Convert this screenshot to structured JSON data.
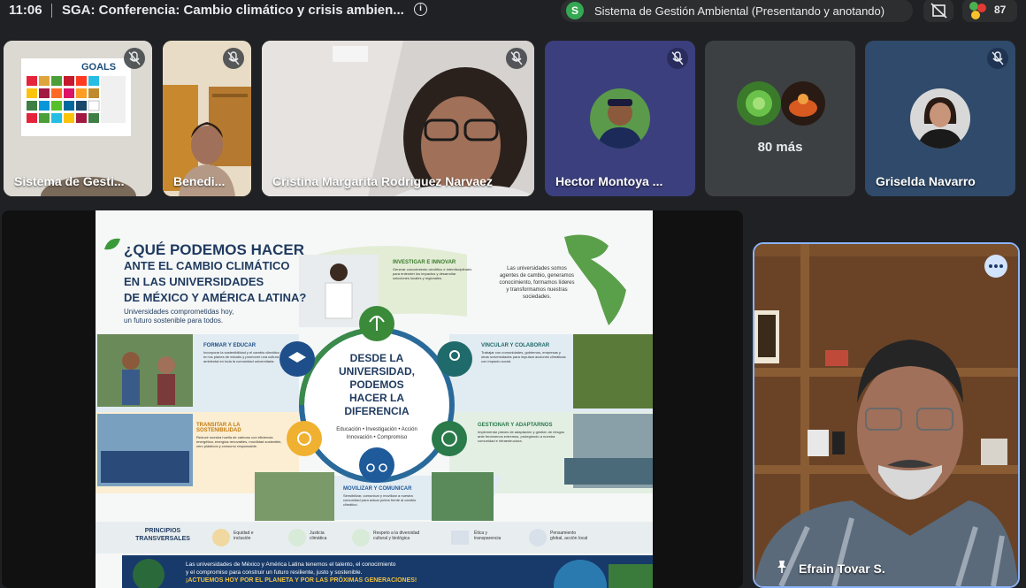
{
  "topbar": {
    "time": "11:06",
    "meeting_title": "SGA: Conferencia: Cambio climático y crisis ambien...",
    "presenter_initial": "S",
    "presenter_status": "Sistema de Gestión Ambiental (Presentando y anotando)",
    "participants_count": "87"
  },
  "tiles": [
    {
      "name": "Sistema de Gesti..."
    },
    {
      "name": "Benedi..."
    },
    {
      "name": "Cristina Margarita Rodriguez Narvaez"
    },
    {
      "name": "Hector Montoya ..."
    },
    {
      "name": "80 más"
    },
    {
      "name": "Griselda Navarro"
    }
  ],
  "sdg_poster": {
    "text": "GOALS"
  },
  "slide": {
    "title_line1": "¿QUÉ PODEMOS HACER",
    "title_line2": "ANTE EL CAMBIO CLIMÁTICO",
    "title_line3": "EN LAS UNIVERSIDADES",
    "title_line4": "DE MÉXICO Y AMÉRICA LATINA?",
    "subtitle_line1": "Universidades comprometidas hoy,",
    "subtitle_line2": "un futuro sostenible para todos.",
    "center_line1": "DESDE LA",
    "center_line2": "UNIVERSIDAD,",
    "center_line3": "PODEMOS",
    "center_line4": "HACER LA",
    "center_line5": "DIFERENCIA",
    "center_sub1": "Educación • Investigación • Acción",
    "center_sub2": "Innovación • Compromiso",
    "intro_line1": "Las universidades somos",
    "intro_line2": "agentes de cambio, generamos",
    "intro_line3": "conocimiento, formamos líderes",
    "intro_line4": "y transformamos nuestras",
    "intro_line5": "sociedades.",
    "sections": [
      {
        "title": "INVESTIGAR E INNOVAR",
        "text": "Generar conocimiento científico e interdisciplinario para entender los impactos y desarrollar soluciones locales y regionales."
      },
      {
        "title": "FORMAR Y EDUCAR",
        "text": "Incorporar la sostenibilidad y el cambio climático en los planes de estudio y promover una cultura ambiental en toda la comunidad universitaria."
      },
      {
        "title": "VINCULAR Y COLABORAR",
        "text": "Trabajar con comunidades, gobiernos, empresas y otras universidades para impulsar acciones climáticas con impacto social."
      },
      {
        "title": "TRANSITAR A LA SOSTENIBILIDAD",
        "text": "Reducir nuestra huella de carbono con eficiencia energética, energías renovables, movilidad sostenible, cero plásticos y consumo responsable."
      },
      {
        "title": "GESTIONAR Y ADAPTARNOS",
        "text": "Implementar planes de adaptación y gestión de riesgos ante fenómenos extremos, protegiendo a nuestra comunidad e infraestructura."
      },
      {
        "title": "MOVILIZAR Y COMUNICAR",
        "text": "Sensibilizar, comunicar y movilizar a nuestra comunidad para actuar juntos frente al cambio climático."
      }
    ],
    "principles_label_line1": "PRINCIPIOS",
    "principles_label_line2": "TRANSVERSALES",
    "principles": [
      {
        "line1": "Equidad e",
        "line2": "inclusión"
      },
      {
        "line1": "Justicia",
        "line2": "climática"
      },
      {
        "line1": "Respeto a la diversidad",
        "line2": "cultural y biológica"
      },
      {
        "line1": "Ética y",
        "line2": "transparencia"
      },
      {
        "line1": "Pensamiento",
        "line2": "global, acción local"
      }
    ],
    "footer_line1": "Las universidades de México y América Latina tenemos el talento, el conocimiento",
    "footer_line2": "y el compromiso para construir un futuro resiliente, justo y sostenible.",
    "footer_cta": "¡ACTUEMOS HOY POR EL PLANETA Y POR LAS PRÓXIMAS GENERACIONES!"
  },
  "speaker": {
    "name": "Efrain Tovar S."
  },
  "colors": {
    "background": "#202124",
    "accent_blue": "#8ab4f8",
    "green": "#34a853",
    "navy": "#1f3a5f"
  }
}
